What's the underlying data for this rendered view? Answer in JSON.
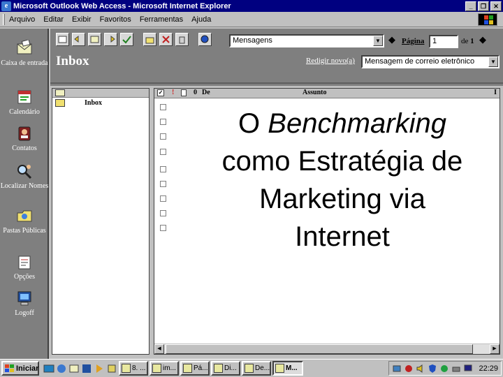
{
  "window": {
    "title": "Microsoft Outlook Web Access - Microsoft Internet Explorer",
    "buttons": [
      "_",
      "❐",
      "✕"
    ]
  },
  "menubar": {
    "items": [
      "Arquivo",
      "Editar",
      "Exibir",
      "Favoritos",
      "Ferramentas",
      "Ajuda"
    ]
  },
  "sidebar": {
    "items": [
      {
        "label": "Caixa de entrada",
        "icon": "inbox-icon"
      },
      {
        "label": "Calendário",
        "icon": "calendar-icon"
      },
      {
        "label": "Contatos",
        "icon": "contacts-icon"
      },
      {
        "label": "Localizar Nomes",
        "icon": "find-names-icon"
      },
      {
        "label": "Pastas Públicas",
        "icon": "public-folders-icon"
      },
      {
        "label": "Opções",
        "icon": "options-icon"
      },
      {
        "label": "Logoff",
        "icon": "logoff-icon"
      }
    ]
  },
  "header": {
    "view_select": "Mensagens",
    "page_label": "Página",
    "page_value": "1",
    "page_of": "de",
    "page_total": "1",
    "inbox_title": "Inbox",
    "compose_link": "Redigir novo(a)",
    "compose_select": "Mensagem de correio eletrônico"
  },
  "folders": {
    "items": [
      "Inbox"
    ]
  },
  "messages": {
    "columns": {
      "flag": "!",
      "from": "De",
      "subject": "Assunto",
      "size": "I"
    },
    "row_count": 9
  },
  "slide": {
    "title_italic": "O Benchmarking",
    "title_line2": "como Estratégia de",
    "title_line3": "Marketing via",
    "title_line4": "Internet"
  },
  "taskbar": {
    "start_label": "Iniciar",
    "tasks": [
      "8. ...",
      "im...",
      "Pá...",
      "Di...",
      "De...",
      "M..."
    ],
    "clock": "22:29"
  },
  "colors": {
    "titlebar": "#000080",
    "sidebar": "#7f7f7f",
    "chrome": "#c0c0c0"
  }
}
